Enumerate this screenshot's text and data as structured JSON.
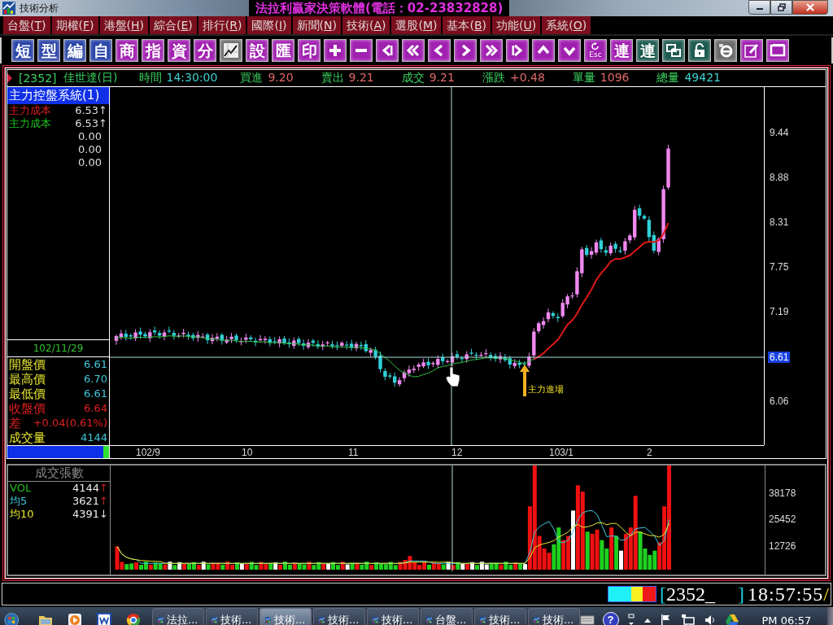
{
  "window": {
    "title": "技術分析",
    "banner": "法拉利贏家決策軟體(電話：02-23832828)"
  },
  "menu": [
    {
      "label": "台盤(T)"
    },
    {
      "label": "期權(F)"
    },
    {
      "label": "港盤(H)"
    },
    {
      "label": "綜合(E)"
    },
    {
      "label": "排行(R)"
    },
    {
      "label": "國際(I)"
    },
    {
      "label": "新聞(N)"
    },
    {
      "label": "技術(A)"
    },
    {
      "label": "選股(M)"
    },
    {
      "label": "基本(B)"
    },
    {
      "label": "功能(U)"
    },
    {
      "label": "系統(O)"
    }
  ],
  "toolbar": [
    {
      "kind": "char",
      "label": "短",
      "color": "#2a44a8"
    },
    {
      "kind": "char",
      "label": "型",
      "color": "#2a44a8"
    },
    {
      "kind": "char",
      "label": "編",
      "color": "#2a44a8"
    },
    {
      "kind": "char",
      "label": "自",
      "color": "#2a44a8"
    },
    {
      "kind": "char",
      "label": "商",
      "color": "#a020b0"
    },
    {
      "kind": "char",
      "label": "指",
      "color": "#a020b0"
    },
    {
      "kind": "char",
      "label": "資",
      "color": "#a020b0"
    },
    {
      "kind": "char",
      "label": "分",
      "color": "#a020b0"
    },
    {
      "kind": "chart",
      "color": "#6a6a6a"
    },
    {
      "kind": "char",
      "label": "設",
      "color": "#a020b0"
    },
    {
      "kind": "char",
      "label": "匯",
      "color": "#a020b0"
    },
    {
      "kind": "char",
      "label": "印",
      "color": "#a020b0"
    },
    {
      "kind": "plus",
      "color": "#a020b0"
    },
    {
      "kind": "minus",
      "color": "#a020b0"
    },
    {
      "kind": "first",
      "color": "#a020b0"
    },
    {
      "kind": "rewind",
      "color": "#a020b0"
    },
    {
      "kind": "prev",
      "color": "#a020b0"
    },
    {
      "kind": "next",
      "color": "#a020b0"
    },
    {
      "kind": "forward",
      "color": "#a020b0"
    },
    {
      "kind": "last",
      "color": "#a020b0"
    },
    {
      "kind": "up",
      "color": "#a020b0"
    },
    {
      "kind": "down",
      "color": "#a020b0"
    },
    {
      "kind": "esc",
      "label": "Esc",
      "color": "#a020b0"
    },
    {
      "kind": "char",
      "label": "連",
      "color": "#a020b0"
    },
    {
      "kind": "char",
      "label": "連",
      "color": "#1e5a50"
    },
    {
      "kind": "windows",
      "color": "#1e5a50"
    },
    {
      "kind": "lock",
      "color": "#1e5a50"
    },
    {
      "kind": "browser",
      "color": "#6a6a6a"
    },
    {
      "kind": "edit",
      "color": "#a020b0"
    },
    {
      "kind": "screen",
      "color": "#a020b0"
    }
  ],
  "quote": {
    "code": "[2352]",
    "name": "佳世達(日)",
    "fields": [
      {
        "label": "時間",
        "value": "14:30:00",
        "kind": "info"
      },
      {
        "label": "買進",
        "value": "9.20",
        "kind": "price"
      },
      {
        "label": "賣出",
        "value": "9.21",
        "kind": "price"
      },
      {
        "label": "成交",
        "value": "9.21",
        "kind": "price"
      },
      {
        "label": "漲跌",
        "value": "+0.48",
        "kind": "price"
      },
      {
        "label": "單量",
        "value": "1096",
        "kind": "price"
      },
      {
        "label": "總量",
        "value": "49421",
        "kind": "info"
      }
    ]
  },
  "indicator": {
    "title": "主力控盤系統(1)",
    "lines": [
      {
        "label": "主力成本",
        "value": "6.53",
        "arrow": "↑",
        "color": "#e02020"
      },
      {
        "label": "主力成本",
        "value": "6.53",
        "arrow": "↑",
        "color": "#20c020"
      },
      {
        "value": "0.00"
      },
      {
        "value": "0.00"
      },
      {
        "value": "0.00"
      }
    ]
  },
  "day_info": {
    "date": "102/11/29",
    "rows": [
      {
        "label": "開盤價",
        "value": "6.61",
        "color": "#e8e830"
      },
      {
        "label": "最高價",
        "value": "6.70",
        "color": "#e8e830"
      },
      {
        "label": "最低價",
        "value": "6.61",
        "color": "#e8e830"
      },
      {
        "label": "收盤價",
        "value": "6.64",
        "color": "#e02020"
      },
      {
        "label": "差",
        "value": "+0.04(0.61%)",
        "color": "#e02020"
      },
      {
        "label": "成交量",
        "value": "4144",
        "color": "#e8e830"
      }
    ]
  },
  "price_axis": [
    {
      "label": "9.44",
      "highlighted": false
    },
    {
      "label": "8.88",
      "highlighted": false
    },
    {
      "label": "8.31",
      "highlighted": false
    },
    {
      "label": "7.75",
      "highlighted": false
    },
    {
      "label": "7.19",
      "highlighted": false
    },
    {
      "label": "6.61",
      "highlighted": true
    },
    {
      "label": "6.06",
      "highlighted": false
    }
  ],
  "date_axis": [
    "102/9",
    "10",
    "11",
    "12",
    "103/1",
    "2"
  ],
  "annotation": "主力進場",
  "volume": {
    "title": "成交張數",
    "rows": [
      {
        "label": "VOL",
        "value": "4144",
        "arrow": "↑",
        "color": "#20c020"
      },
      {
        "label": "均5",
        "value": "3621",
        "arrow": "↑",
        "color": "#40c8e0"
      },
      {
        "label": "均10",
        "value": "4391",
        "arrow": "↓",
        "color": "#e8e830"
      }
    ],
    "axis": [
      "38178",
      "25452",
      "12726"
    ]
  },
  "status": {
    "open": "[",
    "code": "2352_",
    "close": "]",
    "clock": "18:57:55",
    "mark": "/"
  },
  "taskbar": {
    "buttons": [
      {
        "label": "法拉...",
        "selected": false
      },
      {
        "label": "技術...",
        "selected": false
      },
      {
        "label": "技術...",
        "selected": true
      },
      {
        "label": "技術...",
        "selected": false
      },
      {
        "label": "技術...",
        "selected": false
      },
      {
        "label": "台盤...",
        "selected": false
      },
      {
        "label": "技術...",
        "selected": false
      },
      {
        "label": "技術...",
        "selected": false
      }
    ],
    "help": "?",
    "time": "PM 06:57"
  }
}
